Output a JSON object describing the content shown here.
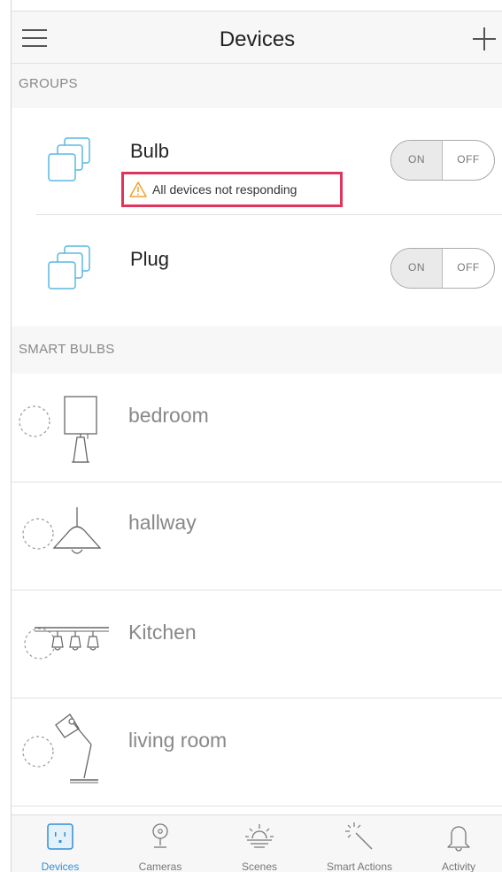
{
  "header": {
    "title": "Devices"
  },
  "groups": {
    "heading": "GROUPS",
    "items": [
      {
        "name": "Bulb",
        "on_label": "ON",
        "off_label": "OFF",
        "warning": "All devices not responding"
      },
      {
        "name": "Plug",
        "on_label": "ON",
        "off_label": "OFF"
      }
    ]
  },
  "smart_bulbs": {
    "heading": "SMART BULBS",
    "items": [
      {
        "name": "bedroom",
        "icon": "table-lamp-icon"
      },
      {
        "name": "hallway",
        "icon": "pendant-lamp-icon"
      },
      {
        "name": "Kitchen",
        "icon": "track-light-icon"
      },
      {
        "name": "living room",
        "icon": "desk-lamp-icon"
      }
    ]
  },
  "tabbar": {
    "tabs": [
      {
        "label": "Devices",
        "icon": "outlet-icon",
        "active": true
      },
      {
        "label": "Cameras",
        "icon": "camera-icon",
        "active": false
      },
      {
        "label": "Scenes",
        "icon": "sunrise-icon",
        "active": false
      },
      {
        "label": "Smart Actions",
        "icon": "magic-wand-icon",
        "active": false
      },
      {
        "label": "Activity",
        "icon": "bell-icon",
        "active": false
      }
    ]
  },
  "colors": {
    "accent": "#2f8fd8",
    "group_icon": "#5ab8e0",
    "warning_border": "#e0345d",
    "warning_icon": "#f0a030"
  }
}
